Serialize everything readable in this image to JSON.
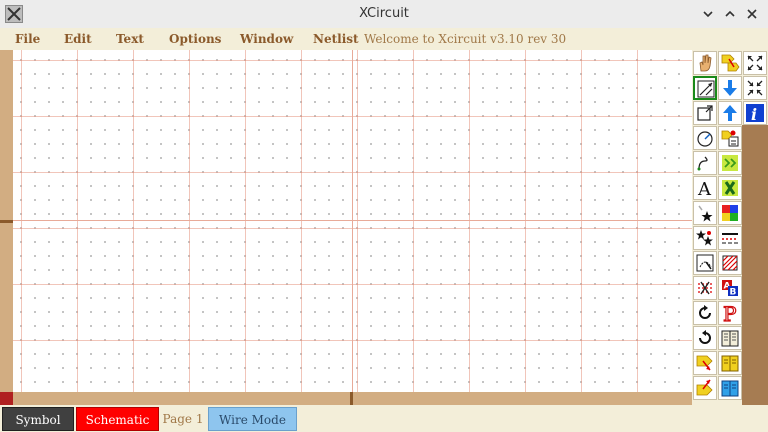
{
  "window": {
    "title": "XCircuit"
  },
  "menu": {
    "items": [
      "File",
      "Edit",
      "Text",
      "Options",
      "Window",
      "Netlist"
    ],
    "status": "Welcome to Xcircuit v3.10 rev 30"
  },
  "statusbar": {
    "symbol_label": "Symbol",
    "schematic_label": "Schematic",
    "page_label": "Page 1",
    "mode_label": "Wire Mode"
  },
  "colors": {
    "menu_text": "#8b5a2b",
    "scroll": "#d2ad82",
    "schematic": "#ff0000",
    "wire_mode": "#8ec5ee",
    "symbol_bg": "#404040",
    "selected_tool": "#1a8a1a"
  },
  "tools": [
    "pan-icon",
    "select-push-icon",
    "fit-zoom-icon",
    "wire-icon",
    "move-down-icon",
    "zoom-in-icon",
    "box-icon",
    "move-up-icon",
    "info-icon",
    "arc-icon",
    "library-directory-icon",
    "spline-icon",
    "library-pink-icon",
    "text-icon",
    "library-green-icon",
    "stars-icon",
    "color-icon",
    "stars-select-icon",
    "line-style-icon",
    "edit-element-icon",
    "fill-pattern-icon",
    "delete-icon",
    "text-style-icon",
    "rotate-cw-icon",
    "parameter-icon",
    "rotate-ccw-icon",
    "page-directory-icon",
    "push-icon",
    "book-yellow-icon",
    "pop-icon",
    "book-blue-icon"
  ]
}
